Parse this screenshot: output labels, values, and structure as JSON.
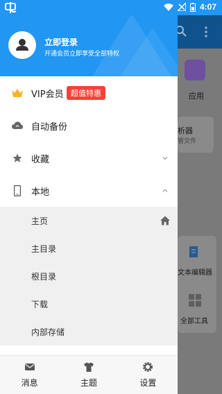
{
  "status_bar": {
    "time": "4:07"
  },
  "drawer": {
    "header": {
      "login_title": "立即登录",
      "login_subtitle": "开通会员立即享受全部特权"
    },
    "menu": {
      "vip": {
        "label": "VIP会员",
        "badge": "超值特惠"
      },
      "backup": {
        "label": "自动备份"
      },
      "favorites": {
        "label": "收藏"
      },
      "local": {
        "label": "本地"
      }
    },
    "local_items": [
      "主页",
      "主目录",
      "根目录",
      "下载",
      "内部存储"
    ],
    "bottom_nav": {
      "messages": "消息",
      "themes": "主题",
      "settings": "设置"
    }
  },
  "background_app": {
    "apps_label": "应用",
    "card1_title": "析器",
    "card1_sub": "管文件",
    "text_editor": "文本编辑器",
    "all_tools": "全部工具"
  },
  "colors": {
    "accent": "#2196f3",
    "badge": "#f44336",
    "scrim": "#7a7a7a"
  }
}
